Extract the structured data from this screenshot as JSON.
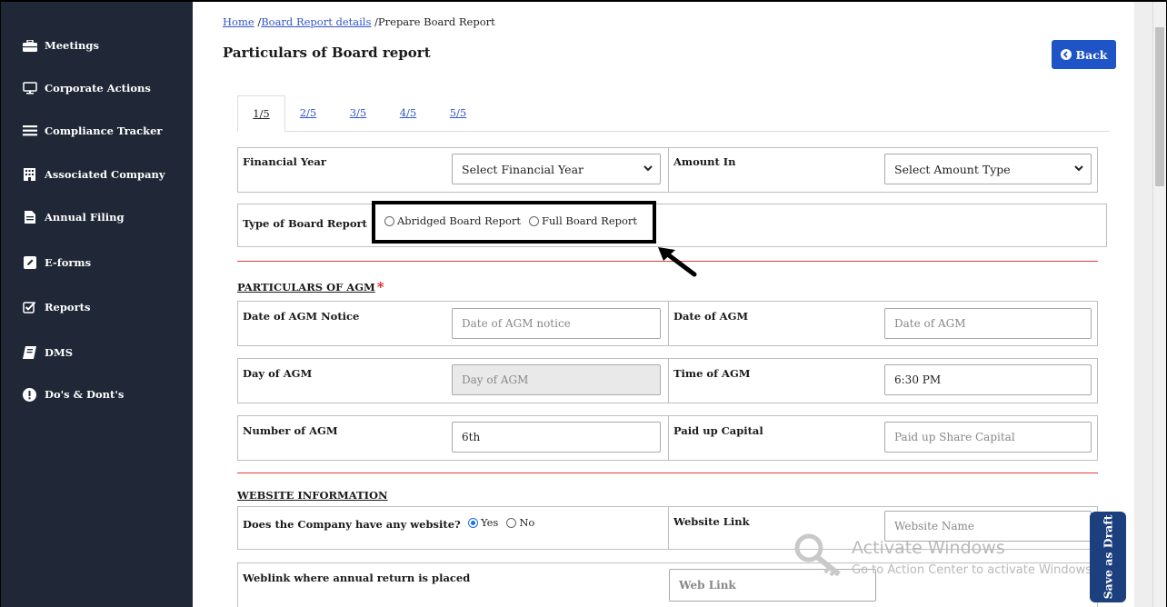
{
  "sidebar": {
    "items": [
      {
        "label": "Meetings",
        "icon": "briefcase-icon"
      },
      {
        "label": "Corporate Actions",
        "icon": "monitor-icon"
      },
      {
        "label": "Compliance Tracker",
        "icon": "list-icon"
      },
      {
        "label": "Associated Company",
        "icon": "building-icon"
      },
      {
        "label": "Annual Filing",
        "icon": "file-icon"
      },
      {
        "label": "E-forms",
        "icon": "edit-square-icon"
      },
      {
        "label": "Reports",
        "icon": "checkbox-icon"
      },
      {
        "label": "DMS",
        "icon": "book-icon"
      },
      {
        "label": "Do's & Dont's",
        "icon": "exclamation-circle-icon"
      }
    ]
  },
  "breadcrumb": {
    "home": "Home",
    "sep1": " /",
    "board_details": "Board Report details",
    "sep2": " /",
    "current": "Prepare Board Report"
  },
  "page_title": "Particulars of Board report",
  "back_button": "Back",
  "tabs": [
    "1/5",
    "2/5",
    "3/5",
    "4/5",
    "5/5"
  ],
  "form": {
    "financial_year_label": "Financial Year",
    "financial_year_value": "Select Financial Year",
    "amount_in_label": "Amount In",
    "amount_in_value": "Select Amount Type",
    "type_label": "Type of Board Report",
    "type_options": [
      "Abridged Board Report",
      "Full Board Report"
    ],
    "agm_section": "PARTICULARS OF AGM",
    "required_mark": "*",
    "agm_notice_label": "Date of AGM Notice",
    "agm_notice_placeholder": "Date of AGM notice",
    "agm_date_label": "Date of AGM",
    "agm_date_placeholder": "Date  of AGM",
    "agm_day_label": "Day of AGM",
    "agm_day_placeholder": "Day of AGM",
    "agm_time_label": "Time of AGM",
    "agm_time_value": "6:30 PM",
    "agm_number_label": "Number of AGM",
    "agm_number_value": "6th",
    "paid_up_label": "Paid up Capital",
    "paid_up_placeholder": "Paid up Share Capital",
    "website_section": "WEBSITE INFORMATION",
    "has_website_label": "Does the Company have any website?",
    "has_website_options": [
      "Yes",
      "No"
    ],
    "has_website_selected": "Yes",
    "website_link_label": "Website Link",
    "website_link_placeholder": "Website Name",
    "weblink_label": "Weblink where annual return is placed",
    "weblink_placeholder": "Web Link"
  },
  "save_draft": "Save as Draft",
  "watermark": {
    "title": "Activate Windows",
    "subtitle": "Go to Action Center to activate Windows."
  },
  "colors": {
    "sidebar_bg": "#202837",
    "primary_blue": "#1f54c7",
    "draft_blue": "#1c3f7e",
    "divider_red": "#e43b3b"
  }
}
